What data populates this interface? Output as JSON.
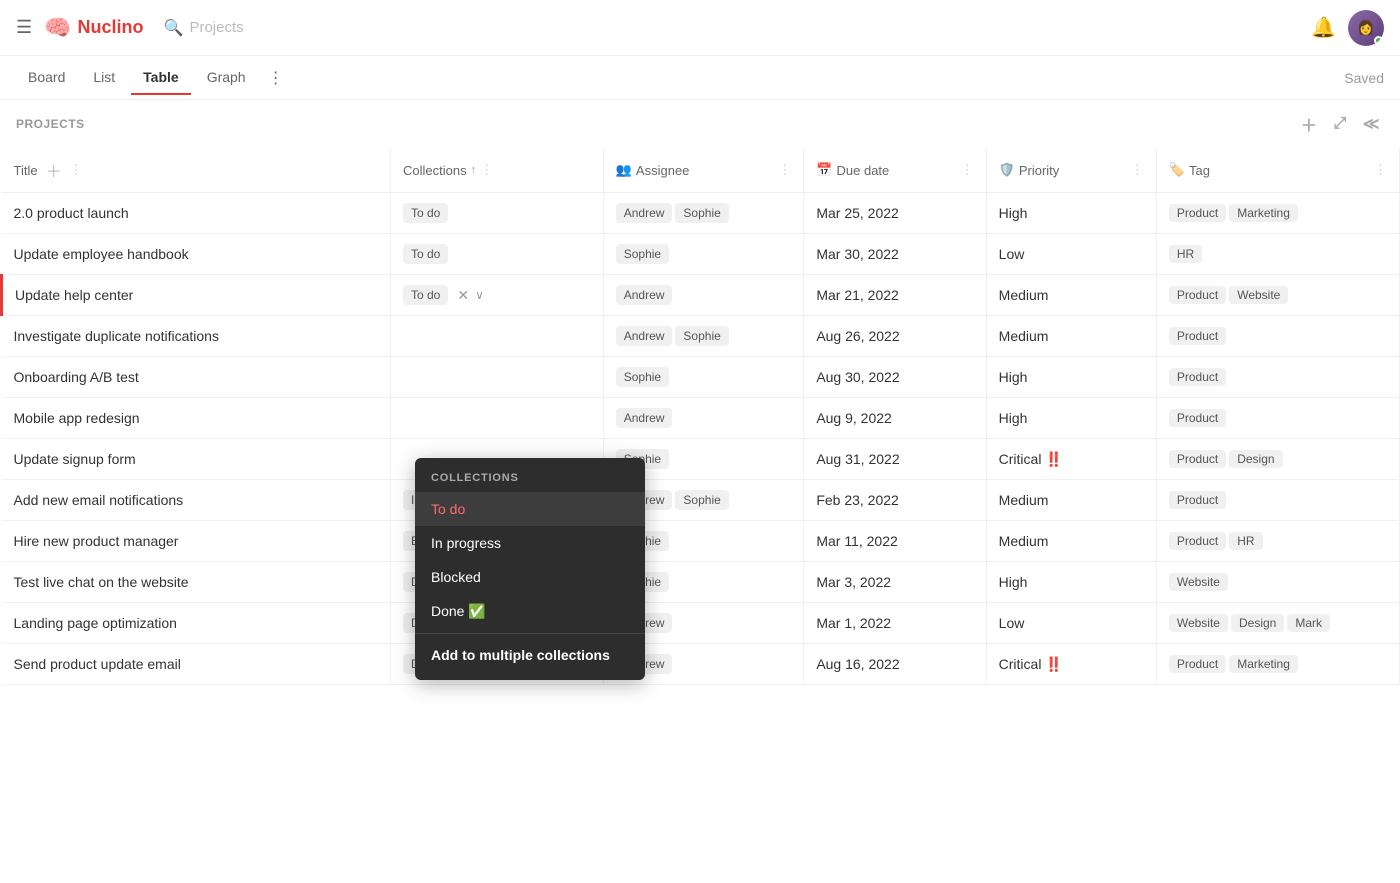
{
  "app": {
    "name": "Nuclino",
    "search_placeholder": "Projects",
    "saved_label": "Saved"
  },
  "tabs": [
    {
      "label": "Board",
      "active": false
    },
    {
      "label": "List",
      "active": false
    },
    {
      "label": "Table",
      "active": true
    },
    {
      "label": "Graph",
      "active": false
    }
  ],
  "section": {
    "label": "PROJECTS"
  },
  "columns": [
    {
      "id": "title",
      "label": "Title",
      "icon": ""
    },
    {
      "id": "collections",
      "label": "Collections",
      "icon": ""
    },
    {
      "id": "assignee",
      "label": "Assignee",
      "icon": "👥"
    },
    {
      "id": "duedate",
      "label": "Due date",
      "icon": "📅"
    },
    {
      "id": "priority",
      "label": "Priority",
      "icon": "🛡️"
    },
    {
      "id": "tag",
      "label": "Tag",
      "icon": "🏷️"
    }
  ],
  "rows": [
    {
      "title": "2.0 product launch",
      "collection": "To do",
      "assignees": [
        "Andrew",
        "Sophie"
      ],
      "duedate": "Mar 25, 2022",
      "priority": "High",
      "priority_critical": false,
      "tags": [
        "Product",
        "Marketing"
      ],
      "active": false
    },
    {
      "title": "Update employee handbook",
      "collection": "To do",
      "assignees": [
        "Sophie"
      ],
      "duedate": "Mar 30, 2022",
      "priority": "Low",
      "priority_critical": false,
      "tags": [
        "HR"
      ],
      "active": false
    },
    {
      "title": "Update help center",
      "collection": "To do",
      "assignees": [
        "Andrew"
      ],
      "duedate": "Mar 21, 2022",
      "priority": "Medium",
      "priority_critical": false,
      "tags": [
        "Product",
        "Website"
      ],
      "active": true
    },
    {
      "title": "Investigate duplicate notifications",
      "collection": "",
      "assignees": [
        "Andrew",
        "Sophie"
      ],
      "duedate": "Aug 26, 2022",
      "priority": "Medium",
      "priority_critical": false,
      "tags": [
        "Product"
      ],
      "active": false
    },
    {
      "title": "Onboarding A/B test",
      "collection": "",
      "assignees": [
        "Sophie"
      ],
      "duedate": "Aug 30, 2022",
      "priority": "High",
      "priority_critical": false,
      "tags": [
        "Product"
      ],
      "active": false
    },
    {
      "title": "Mobile app redesign",
      "collection": "",
      "assignees": [
        "Andrew"
      ],
      "duedate": "Aug 9, 2022",
      "priority": "High",
      "priority_critical": false,
      "tags": [
        "Product"
      ],
      "active": false
    },
    {
      "title": "Update signup form",
      "collection": "",
      "assignees": [
        "Sophie"
      ],
      "duedate": "Aug 31, 2022",
      "priority": "Critical",
      "priority_critical": true,
      "tags": [
        "Product",
        "Design"
      ],
      "active": false
    },
    {
      "title": "Add new email notifications",
      "collection": "In progress",
      "assignees": [
        "Andrew",
        "Sophie"
      ],
      "duedate": "Feb 23, 2022",
      "priority": "Medium",
      "priority_critical": false,
      "tags": [
        "Product"
      ],
      "active": false
    },
    {
      "title": "Hire new product manager",
      "collection": "Blocked",
      "assignees": [
        "Sophie"
      ],
      "duedate": "Mar 11, 2022",
      "priority": "Medium",
      "priority_critical": false,
      "tags": [
        "Product",
        "HR"
      ],
      "active": false
    },
    {
      "title": "Test live chat on the website",
      "collection": "Done ✅",
      "assignees": [
        "Sophie"
      ],
      "duedate": "Mar 3, 2022",
      "priority": "High",
      "priority_critical": false,
      "tags": [
        "Website"
      ],
      "active": false
    },
    {
      "title": "Landing page optimization",
      "collection": "Done ✅",
      "assignees": [
        "Andrew"
      ],
      "duedate": "Mar 1, 2022",
      "priority": "Low",
      "priority_critical": false,
      "tags": [
        "Website",
        "Design",
        "Mark"
      ],
      "active": false
    },
    {
      "title": "Send product update email",
      "collection": "Done ✅",
      "assignees": [
        "Andrew"
      ],
      "duedate": "Aug 16, 2022",
      "priority": "Critical",
      "priority_critical": true,
      "tags": [
        "Product",
        "Marketing"
      ],
      "active": false
    }
  ],
  "dropdown": {
    "label": "COLLECTIONS",
    "items": [
      {
        "label": "To do",
        "active": true
      },
      {
        "label": "In progress",
        "active": false
      },
      {
        "label": "Blocked",
        "active": false
      },
      {
        "label": "Done ✅",
        "active": false
      }
    ],
    "add_label": "Add to multiple collections"
  }
}
